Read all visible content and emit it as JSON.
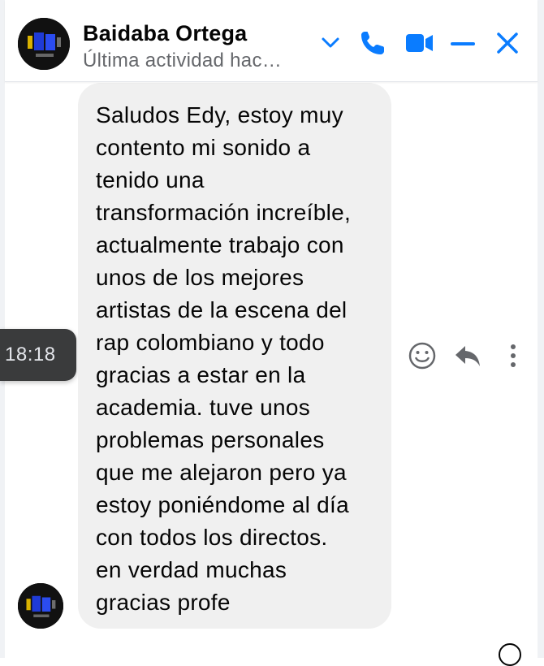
{
  "chat_header": {
    "contact_name": "Baidaba Ortega",
    "status": "Última actividad hac…",
    "icons": [
      "chevron-down-icon",
      "phone-icon",
      "video-camera-icon",
      "minimize-icon",
      "close-icon"
    ],
    "accent_color": "#0a7cff"
  },
  "message": {
    "timestamp": "18:18",
    "text": "Saludos Edy, estoy muy\ncontento mi sonido a\ntenido una\ntransformación increíble,\nactualmente trabajo con\nunos de los mejores\nartistas de la escena del\nrap colombiano y todo\ngracias a estar en la\nacademia. tuve unos\nproblemas personales\nque me alejaron pero ya\nestoy poniéndome al día\ncon todos los directos.\nen verdad muchas\ngracias profe",
    "bubble_color": "#f0f0f0",
    "actions": [
      "smiley-icon",
      "reply-icon",
      "more-vertical-icon"
    ]
  }
}
